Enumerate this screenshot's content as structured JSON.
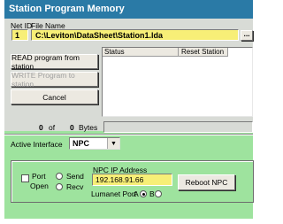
{
  "window": {
    "title": "Station Program Memory"
  },
  "file": {
    "netid_label": "Net ID",
    "filename_label": "File Name",
    "netid_value": "1",
    "path_value": "C:\\Leviton\\DataSheet\\Station1.lda",
    "browse_label": "..."
  },
  "buttons": {
    "read": "READ program from station",
    "write": "WRITE Program to station",
    "cancel": "Cancel",
    "reboot": "Reboot NPC"
  },
  "status": {
    "col_status": "Status",
    "col_reset": "Reset Station"
  },
  "bytes": {
    "current": "0",
    "of": "of",
    "total": "0",
    "unit": "Bytes"
  },
  "interface": {
    "label": "Active Interface",
    "value": "NPC"
  },
  "port": {
    "port_label": "Port",
    "open_label": "Open",
    "send_label": "Send",
    "recv_label": "Recv",
    "ip_label": "NPC IP Address",
    "ip_value": "192.168.91.66",
    "lumanet_label": "Lumanet Port",
    "a_label": "A",
    "b_label": "B"
  },
  "colors": {
    "title_bar": "#2a7aa6",
    "panel": "#d8dbd6",
    "green_panel": "#9ee39e",
    "highlight_field": "#f7ef77"
  }
}
